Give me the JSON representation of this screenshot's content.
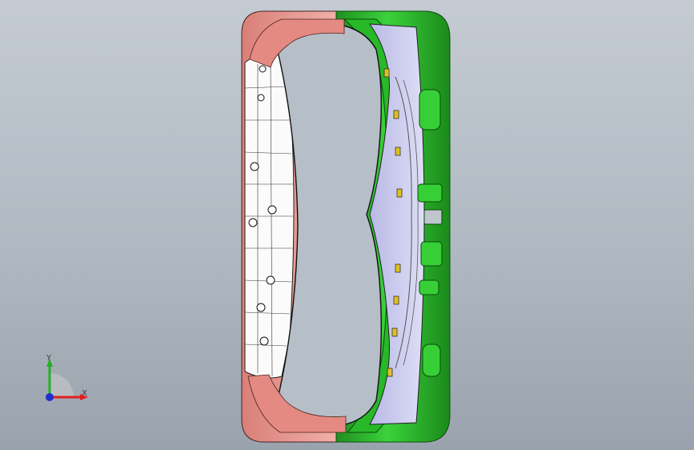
{
  "triad": {
    "x_label": "X",
    "y_label": "Y",
    "x_color": "#e02020",
    "y_color": "#22b022",
    "z_color": "#2030d0"
  },
  "model": {
    "colors": {
      "frame_green": "#2fc52f",
      "frame_green_dark": "#167a16",
      "panel_lavender": "#c8c8ee",
      "panel_white": "#fbfbfb",
      "frame_pink": "#e99a92",
      "clip_yellow": "#e0c020"
    }
  }
}
